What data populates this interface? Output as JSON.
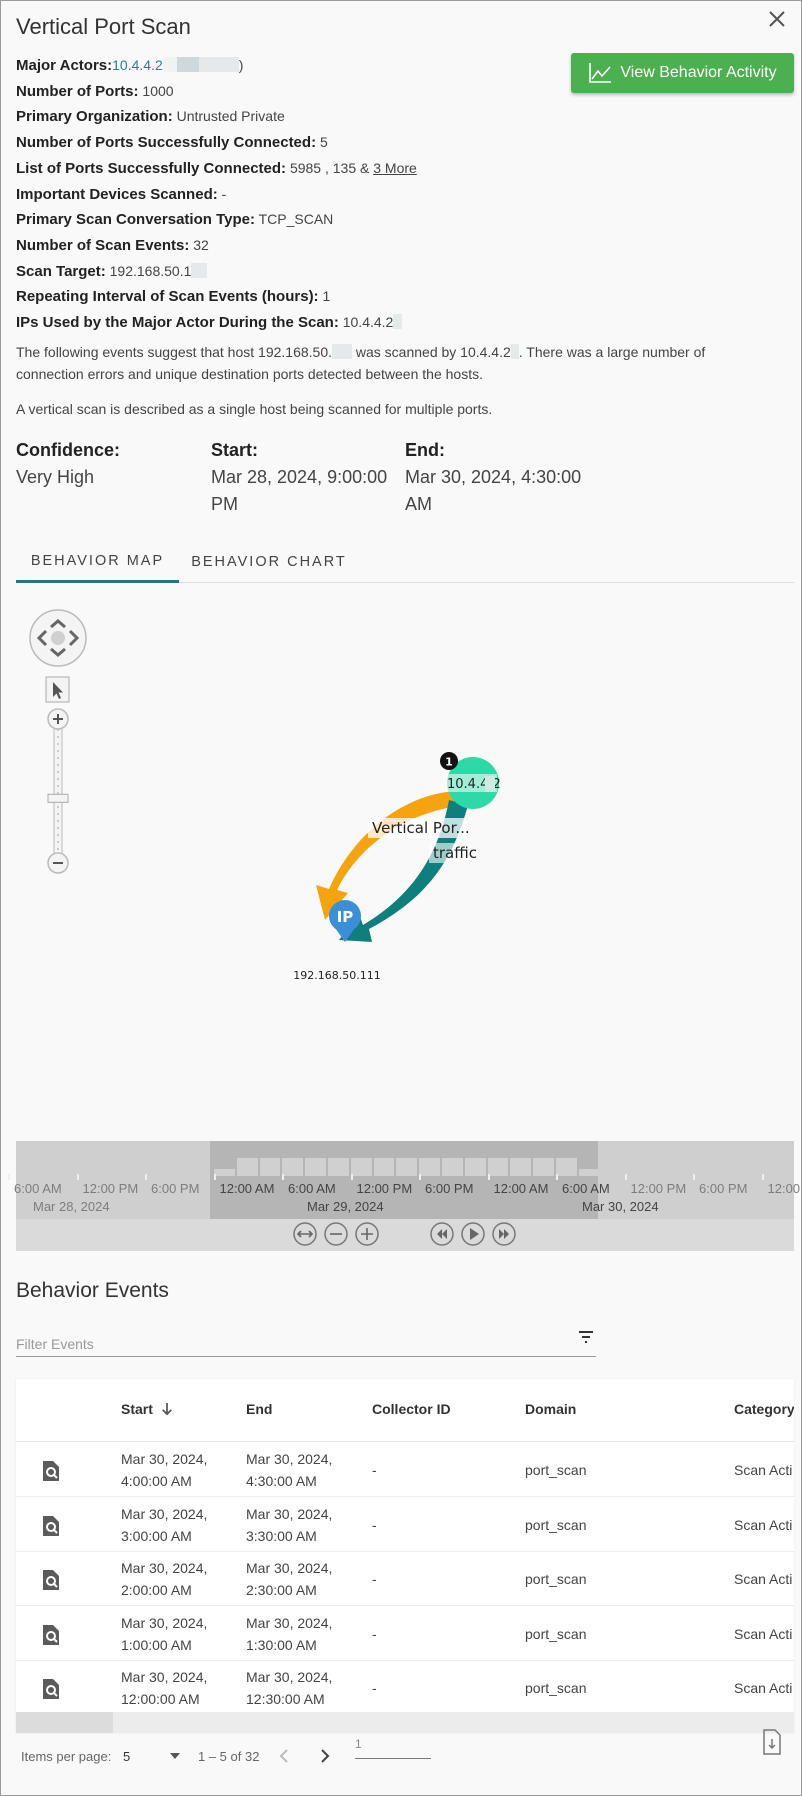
{
  "dialog": {
    "title": "Vertical Port Scan",
    "close_icon": "close-icon",
    "view_button_label": "View Behavior Activity",
    "view_button_icon": "line-chart-icon",
    "accent_green": "#4caf50",
    "accent_teal": "#2a7382"
  },
  "properties": [
    {
      "key": "Major Actors:",
      "value": "10.4.4.2",
      "suffix": ")",
      "redacted": true,
      "link": true
    },
    {
      "key": "Number of Ports:",
      "value": "1000"
    },
    {
      "key": "Primary Organization:",
      "value": "Untrusted Private"
    },
    {
      "key": "Number of Ports Successfully Connected:",
      "value": "5"
    },
    {
      "key": "List of Ports Successfully Connected:",
      "value": "5985 , 135 & ",
      "more_link": "3 More"
    },
    {
      "key": "Important Devices Scanned:",
      "value": "-"
    },
    {
      "key": "Primary Scan Conversation Type:",
      "value": "TCP_SCAN"
    },
    {
      "key": "Number of Scan Events:",
      "value": "32"
    },
    {
      "key": "Scan Target:",
      "value": "192.168.50.1",
      "redacted": true
    },
    {
      "key": "Repeating Interval of Scan Events (hours):",
      "value": "1"
    },
    {
      "key": "IPs Used by the Major Actor During the Scan:",
      "value": "10.4.4.2",
      "redacted": true
    }
  ],
  "description": {
    "part1": "The following events suggest that host 192.168.50.",
    "part2": " was scanned by 10.4.4.2",
    "part3": ". There was a large number of connection errors and unique destination ports detected between the hosts.",
    "line2": "A vertical scan is described as a single host being scanned for multiple ports."
  },
  "summary": {
    "confidence_label": "Confidence:",
    "confidence_value": "Very High",
    "start_label": "Start:",
    "start_value_1": "Mar 28, 2024, 9:00:00",
    "start_value_2": "PM",
    "end_label": "End:",
    "end_value_1": "Mar 30, 2024, 4:30:00",
    "end_value_2": "AM"
  },
  "tabs": [
    {
      "label": "BEHAVIOR MAP",
      "active": true
    },
    {
      "label": "BEHAVIOR CHART",
      "active": false
    }
  ],
  "map": {
    "controls": {
      "pan": "pan-control-icon",
      "select": "pointer-icon",
      "zoom_in": "zoom-in-icon",
      "zoom_out": "zoom-out-icon",
      "zoom_level": 0.45
    },
    "nodes": [
      {
        "id": "actor",
        "label": "10.4.4.2",
        "badge": "1",
        "color": "#2ed9a8"
      },
      {
        "id": "target",
        "label": "192.168.50.111",
        "pin_text": "IP",
        "color": "#3b8fd6"
      }
    ],
    "edges": [
      {
        "label": "Vertical Por...",
        "color": "#f5a40f"
      },
      {
        "label": "traffic",
        "color": "#0e7f7c"
      }
    ]
  },
  "timeline": {
    "ticks": [
      {
        "label": "6:00 AM",
        "in": false
      },
      {
        "label": "12:00 PM",
        "in": false
      },
      {
        "label": "6:00 PM",
        "in": false
      },
      {
        "label": "12:00 AM",
        "in": true
      },
      {
        "label": "6:00 AM",
        "in": true
      },
      {
        "label": "12:00 PM",
        "in": true
      },
      {
        "label": "6:00 PM",
        "in": true
      },
      {
        "label": "12:00 AM",
        "in": true
      },
      {
        "label": "6:00 AM",
        "in": true
      },
      {
        "label": "12:00 PM",
        "in": false
      },
      {
        "label": "6:00 PM",
        "in": false
      },
      {
        "label": "12:00",
        "in": false
      }
    ],
    "dates": [
      {
        "label": "Mar 28, 2024",
        "in": false
      },
      {
        "label": "Mar 29, 2024",
        "in": true
      },
      {
        "label": "Mar 30, 2024",
        "in": true
      }
    ],
    "controls": [
      "fit-icon",
      "zoom-out-icon",
      "zoom-in-icon",
      "rewind-icon",
      "play-icon",
      "fast-forward-icon"
    ]
  },
  "events": {
    "title": "Behavior Events",
    "filter_placeholder": "Filter Events",
    "filter_icon": "filter-icon",
    "columns": [
      "",
      "Start",
      "End",
      "Collector ID",
      "Domain",
      "Category"
    ],
    "sort_icon": "arrow-down-icon",
    "rows": [
      {
        "start1": "Mar 30, 2024,",
        "start2": "4:00:00 AM",
        "end1": "Mar 30, 2024,",
        "end2": "4:30:00 AM",
        "collector": "-",
        "domain": "port_scan",
        "category": "Scan Acti"
      },
      {
        "start1": "Mar 30, 2024,",
        "start2": "3:00:00 AM",
        "end1": "Mar 30, 2024,",
        "end2": "3:30:00 AM",
        "collector": "-",
        "domain": "port_scan",
        "category": "Scan Acti"
      },
      {
        "start1": "Mar 30, 2024,",
        "start2": "2:00:00 AM",
        "end1": "Mar 30, 2024,",
        "end2": "2:30:00 AM",
        "collector": "-",
        "domain": "port_scan",
        "category": "Scan Acti"
      },
      {
        "start1": "Mar 30, 2024,",
        "start2": "1:00:00 AM",
        "end1": "Mar 30, 2024,",
        "end2": "1:30:00 AM",
        "collector": "-",
        "domain": "port_scan",
        "category": "Scan Acti"
      },
      {
        "start1": "Mar 30, 2024,",
        "start2": "12:00:00 AM",
        "end1": "Mar 30, 2024,",
        "end2": "12:30:00 AM",
        "collector": "-",
        "domain": "port_scan",
        "category": "Scan Acti"
      }
    ],
    "row_icon": "file-search-icon"
  },
  "pagination": {
    "items_per_page_label": "Items per page:",
    "items_per_page_value": "5",
    "range": "1 – 5 of 32",
    "page_input": "1",
    "export_icon": "file-download-icon"
  }
}
